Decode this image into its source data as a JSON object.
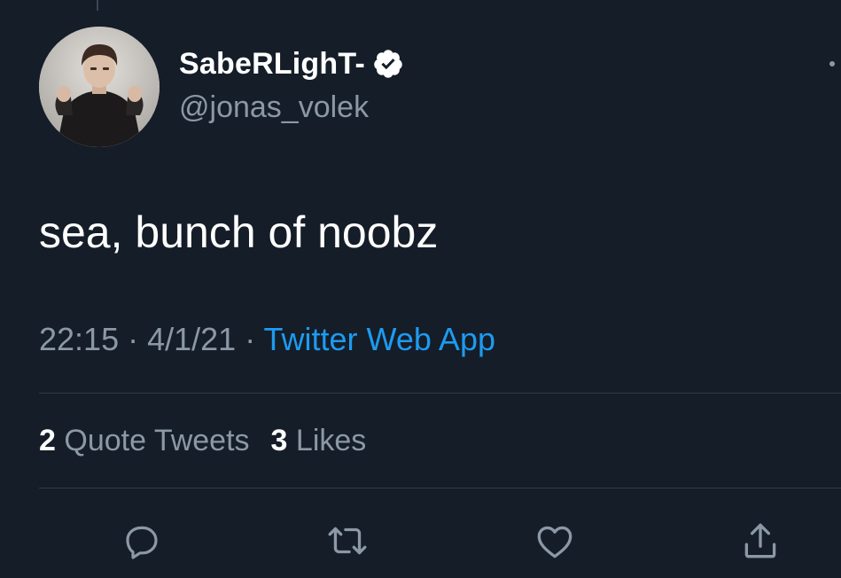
{
  "author": {
    "display_name": "SabeRLighT-",
    "handle": "@jonas_volek",
    "verified": true
  },
  "tweet": {
    "text": "sea, bunch of noobz",
    "time": "22:15",
    "date": "4/1/21",
    "separator": " · ",
    "source": "Twitter Web App"
  },
  "stats": {
    "quote_tweets_count": "2",
    "quote_tweets_label": "Quote Tweets",
    "likes_count": "3",
    "likes_label": "Likes"
  },
  "actions": [
    {
      "icon": "reply-icon"
    },
    {
      "icon": "retweet-icon"
    },
    {
      "icon": "like-icon"
    },
    {
      "icon": "share-icon"
    }
  ],
  "colors": {
    "background": "#151d28",
    "primary_text": "#ffffff",
    "secondary_text": "#8b98a5",
    "link": "#1d9bf0",
    "divider": "#2f3a46"
  }
}
